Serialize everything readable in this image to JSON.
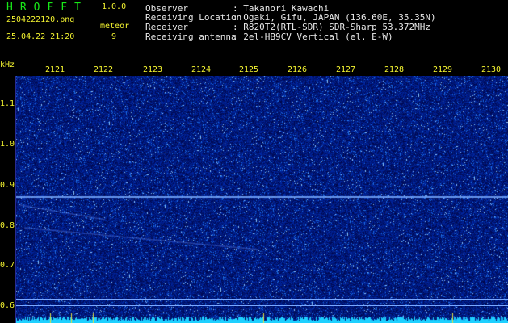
{
  "header": {
    "brand": "HROFFT",
    "version": "1.0.0",
    "filename": "2504222120.png",
    "mode_label": "meteor",
    "datetime": "25.04.22 21:20",
    "count": "9"
  },
  "info": [
    {
      "label": "Observer",
      "value": ": Takanori Kawachi"
    },
    {
      "label": "Receiving Location",
      "value": ": Ogaki, Gifu, JAPAN (136.60E, 35.35N)"
    },
    {
      "label": "Receiver",
      "value": ": R820T2(RTL-SDR) SDR-Sharp 53.372MHz"
    },
    {
      "label": "Receiving antenna",
      "value": ": 2el-HB9CV Vertical (el. E-W)"
    }
  ],
  "axes": {
    "y_unit": "kHz",
    "x_ticks": [
      "2121",
      "2122",
      "2123",
      "2124",
      "2125",
      "2126",
      "2127",
      "2128",
      "2129",
      "2130"
    ],
    "y_ticks": [
      "1.1",
      "1.0",
      "0.9",
      "0.8",
      "0.7",
      "0.6"
    ]
  },
  "colors": {
    "background": "#000000",
    "spectrogram_base": "#00035a",
    "label_yellow": "#f4f430",
    "brand_green": "#18e818",
    "carrier_line": "#7aa8ff"
  }
}
